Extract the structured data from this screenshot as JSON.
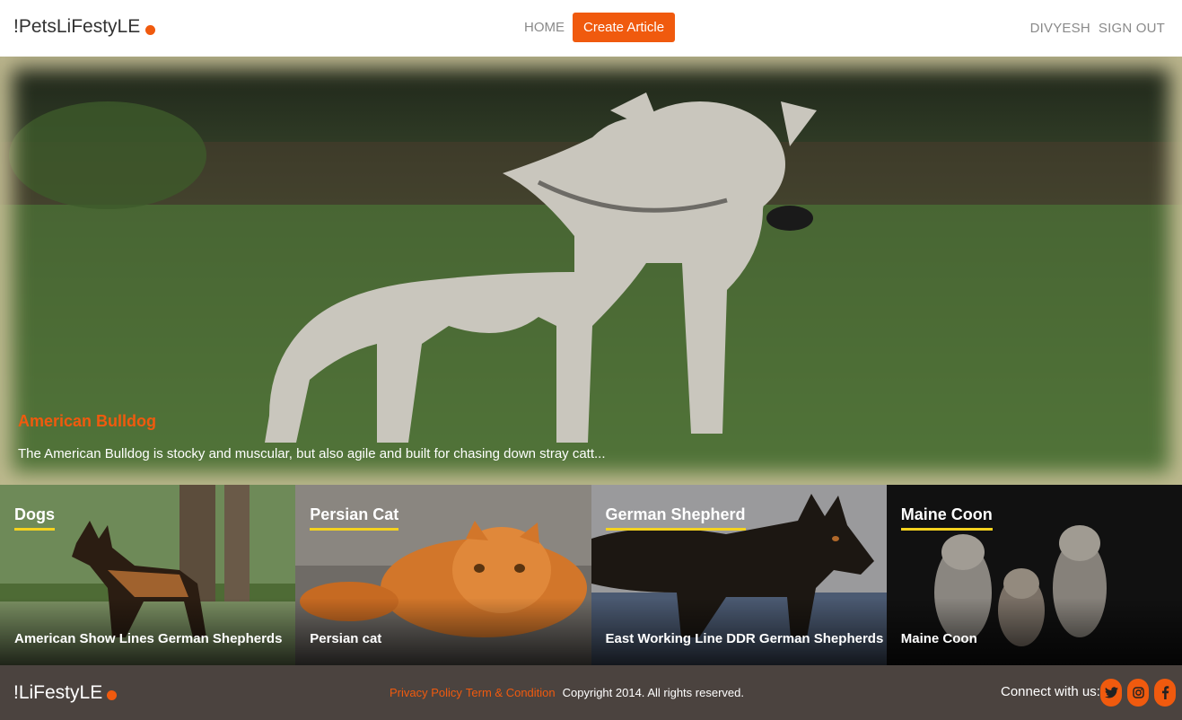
{
  "header": {
    "brand": "!PetsLiFestyLE",
    "nav_home": "HOME",
    "create_label": "Create Article",
    "user": "DIVYESH",
    "signout": "SIGN OUT"
  },
  "hero": {
    "title": "American Bulldog",
    "text": "The American Bulldog is stocky and muscular, but also agile and built for chasing down stray catt..."
  },
  "tiles": [
    {
      "category": "Dogs",
      "title": "American Show Lines German Shepherds"
    },
    {
      "category": "Persian Cat",
      "title": "Persian cat"
    },
    {
      "category": "German Shepherd",
      "title": "East Working Line DDR German Shepherds"
    },
    {
      "category": "Maine Coon",
      "title": "Maine Coon"
    }
  ],
  "footer": {
    "brand": "!LiFestyLE",
    "privacy": "Privacy Policy",
    "terms": "Term & Condition",
    "copyright": "Copyright 2014. All rights reserved.",
    "connect": "Connect with us:",
    "social_icons": [
      "twitter-icon",
      "instagram-icon",
      "facebook-icon"
    ]
  },
  "colors": {
    "accent": "#f05a0e",
    "underline": "#f4d21f",
    "footer_bg": "#4b433f"
  }
}
